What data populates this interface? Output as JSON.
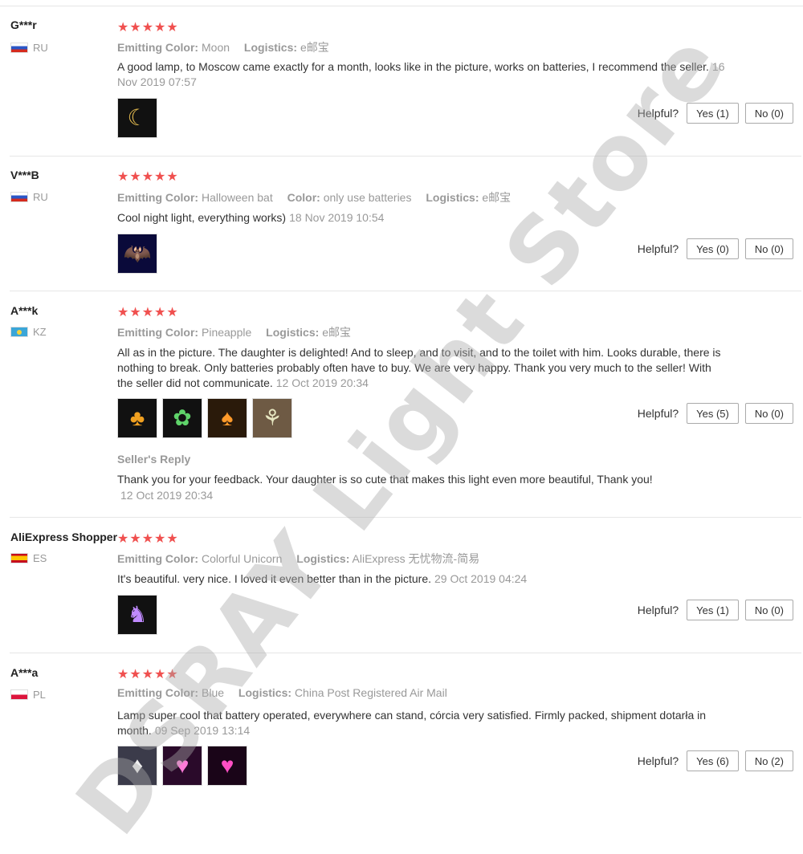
{
  "helpful_label": "Helpful?",
  "watermark": "DSRAY Light Store",
  "reviews": [
    {
      "user": "G***r",
      "country": "RU",
      "stars": "★★★★★",
      "attributes": [
        {
          "key": "Emitting Color:",
          "value": "Moon"
        },
        {
          "key": "Logistics:",
          "value": "e邮宝"
        }
      ],
      "text": "A good lamp, to Moscow came exactly for a month, looks like in the picture, works on batteries, I recommend the seller.",
      "date": "16 Nov 2019 07:57",
      "yes": "Yes (1)",
      "no": "No (0)"
    },
    {
      "user": "V***B",
      "country": "RU",
      "stars": "★★★★★",
      "attributes": [
        {
          "key": "Emitting Color:",
          "value": "Halloween bat"
        },
        {
          "key": "Color:",
          "value": "only use batteries"
        },
        {
          "key": "Logistics:",
          "value": "e邮宝"
        }
      ],
      "text": "Cool night light, everything works)",
      "date": "18 Nov 2019 10:54",
      "yes": "Yes (0)",
      "no": "No (0)"
    },
    {
      "user": "A***k",
      "country": "KZ",
      "stars": "★★★★★",
      "attributes": [
        {
          "key": "Emitting Color:",
          "value": "Pineapple"
        },
        {
          "key": "Logistics:",
          "value": "e邮宝"
        }
      ],
      "text": "All as in the picture. The daughter is delighted! And to sleep, and to visit, and to the toilet with him. Looks durable, there is nothing to break. Only batteries probably often have to buy. We are very happy. Thank you very much to the seller! With the seller did not communicate.",
      "date": "12 Oct 2019 20:34",
      "yes": "Yes (5)",
      "no": "No (0)",
      "reply_title": "Seller's Reply",
      "reply_text": "Thank you for your feedback. Your daughter is so cute that makes this light even more beautiful, Thank you!",
      "reply_date": "12 Oct 2019 20:34"
    },
    {
      "user": "AliExpress Shopper",
      "country": "ES",
      "stars": "★★★★★",
      "attributes": [
        {
          "key": "Emitting Color:",
          "value": "Colorful Unicorn"
        },
        {
          "key": "Logistics:",
          "value": "AliExpress 无忧物流-简易"
        }
      ],
      "text": "It's beautiful. very nice. I loved it even better than in the picture.",
      "date": "29 Oct 2019 04:24",
      "yes": "Yes (1)",
      "no": "No (0)"
    },
    {
      "user": "A***a",
      "country": "PL",
      "stars": "★★★★★",
      "attributes": [
        {
          "key": "Emitting Color:",
          "value": "Blue"
        },
        {
          "key": "Logistics:",
          "value": "China Post Registered Air Mail"
        }
      ],
      "text": "Lamp super cool that battery operated, everywhere can stand, córcia very satisfied. Firmly packed, shipment dotarła in month.",
      "date": "09 Sep 2019 13:14",
      "yes": "Yes (6)",
      "no": "No (2)"
    }
  ]
}
